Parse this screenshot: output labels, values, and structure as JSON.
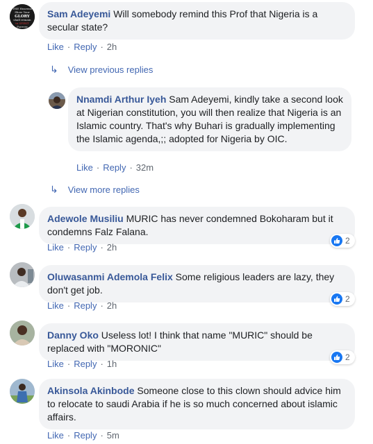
{
  "comments": [
    {
      "author": "Sam Adeyemi",
      "text": "Will somebody remind this Prof that Nigeria is a secular state?",
      "like": "Like",
      "reply": "Reply",
      "time": "2h"
    },
    {
      "author": "Nnamdi Arthur Iyeh",
      "text": "Sam Adeyemi, kindly take a second look at Nigerian constitution, you will then realize that Nigeria is an Islamic country. That's why Buhari is gradually implementing the Islamic agenda,;; adopted for Nigeria by OIC.",
      "like": "Like",
      "reply": "Reply",
      "time": "32m"
    },
    {
      "author": "Adewole Musiliu",
      "text": "MURIC has never condemned Bokoharam but it condemns Falz Falana.",
      "like": "Like",
      "reply": "Reply",
      "time": "2h",
      "reactions": "2"
    },
    {
      "author": "Oluwasanmi Ademola Felix",
      "text": "Some religious leaders are lazy, they don't get job.",
      "like": "Like",
      "reply": "Reply",
      "time": "2h",
      "reactions": "2"
    },
    {
      "author": "Danny Oko",
      "text": "Useless lot! I think that name \"MURIC\" should be replaced with \"MORONIC\"",
      "like": "Like",
      "reply": "Reply",
      "time": "1h",
      "reactions": "2"
    },
    {
      "author": "Akinsola Akinbode",
      "text": "Someone close to this clown should advice him to relocate to saudi Arabia if he is so much concerned about islamic affairs.",
      "like": "Like",
      "reply": "Reply",
      "time": "5m"
    }
  ],
  "view_previous_replies": "View previous replies",
  "view_more_replies": "View more replies",
  "avatar_text": {
    "sam_adeyemi": [
      "THE Heavens",
      "Show Your",
      "GLORY",
      "shall remain",
      "in SPIRIT",
      "Forever"
    ]
  },
  "colors": {
    "author": "#385898",
    "link": "#4267b2",
    "bubble": "#f2f3f5",
    "like_badge": "#1877f2"
  },
  "icons": {
    "reply_arrow": "reply-arrow-icon",
    "like": "like-thumb-icon"
  }
}
